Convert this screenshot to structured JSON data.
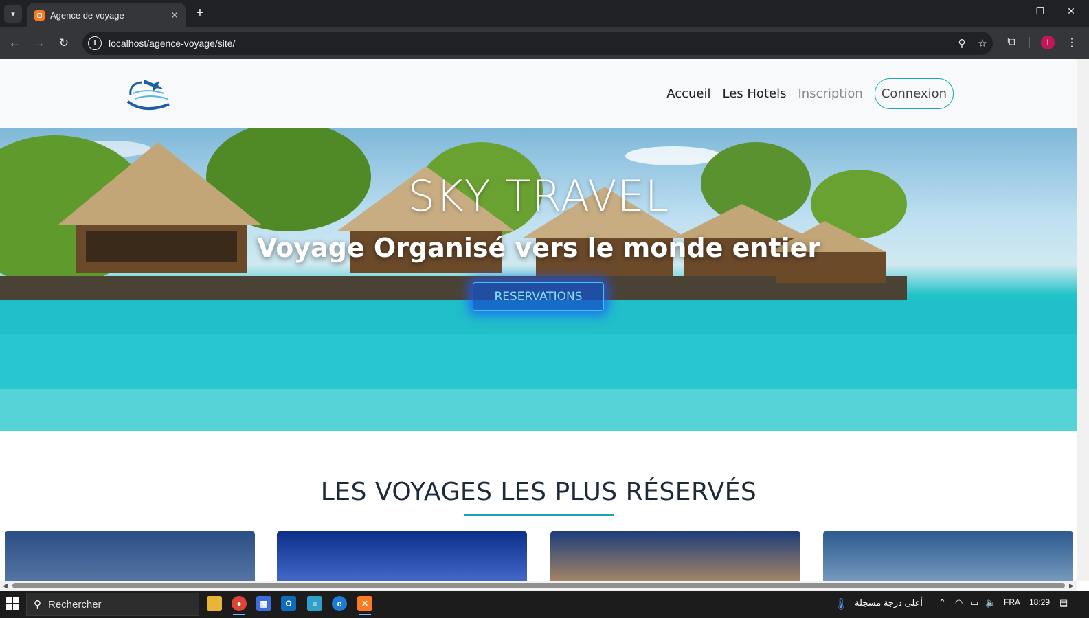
{
  "browser": {
    "tab_title": "Agence de voyage",
    "tab_close": "✕",
    "new_tab": "+",
    "url": "localhost/agence-voyage/site/",
    "profile_initial": "I"
  },
  "site": {
    "nav": {
      "accueil": "Accueil",
      "hotels": "Les Hotels",
      "inscription": "Inscription",
      "connexion": "Connexion"
    },
    "hero": {
      "title": "SKY TRAVEL",
      "subtitle": "Voyage Organisé vers le monde entier",
      "button": "RESERVATIONS"
    },
    "section_title": "LES VOYAGES LES PLUS RÉSERVÉS",
    "accent_color": "#1aa3b6"
  },
  "taskbar": {
    "search_placeholder": "Rechercher",
    "weather_text": "أعلى درجة مسجلة",
    "language": "FRA",
    "time": "18:29"
  }
}
